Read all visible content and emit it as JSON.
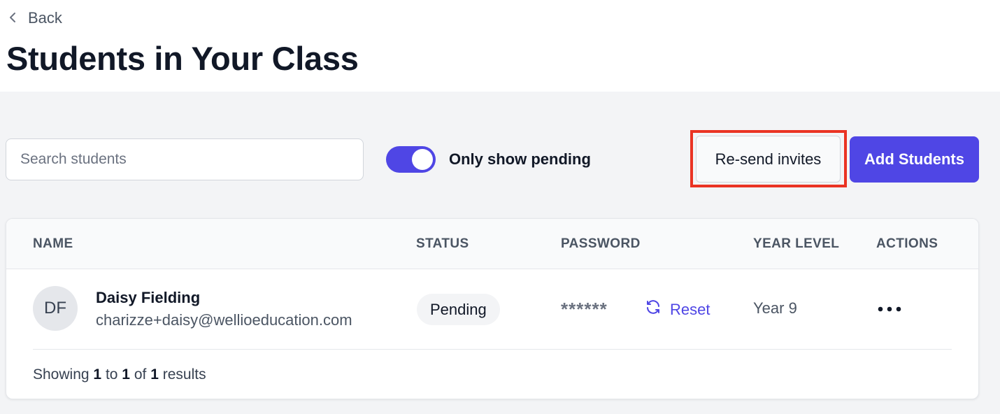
{
  "header": {
    "back_label": "Back",
    "title": "Students in Your Class"
  },
  "toolbar": {
    "search_placeholder": "Search students",
    "toggle_label": "Only show pending",
    "toggle_on": true,
    "resend_label": "Re-send invites",
    "add_label": "Add Students"
  },
  "table": {
    "columns": [
      "NAME",
      "STATUS",
      "PASSWORD",
      "YEAR LEVEL",
      "ACTIONS"
    ],
    "rows": [
      {
        "initials": "DF",
        "name": "Daisy Fielding",
        "email": "charizze+daisy@wellioeducation.com",
        "status": "Pending",
        "password": "******",
        "reset_label": "Reset",
        "year_level": "Year 9",
        "actions_icon": "more-horizontal-icon"
      }
    ]
  },
  "footer": {
    "prefix": "Showing",
    "from": "1",
    "to_word": "to",
    "to": "1",
    "of_word": "of",
    "total": "1",
    "suffix": "results"
  },
  "colors": {
    "primary": "#4f46e5",
    "highlight": "#ea3323",
    "page_bg": "#f3f4f6"
  }
}
